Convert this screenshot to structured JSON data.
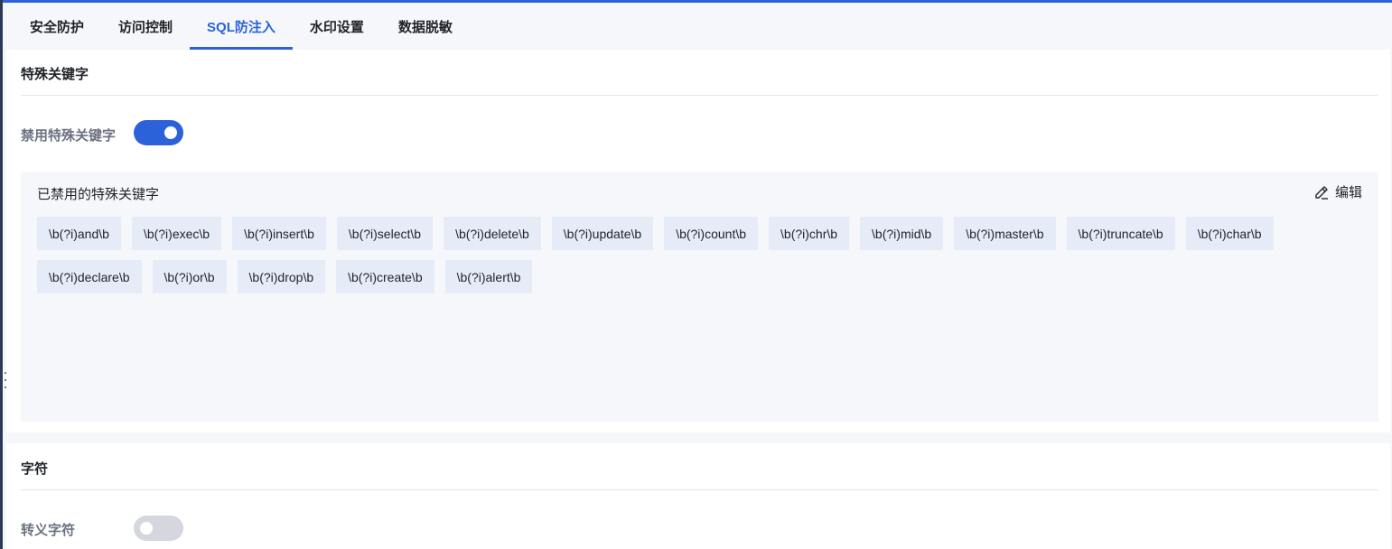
{
  "tabs": [
    {
      "label": "安全防护",
      "active": false
    },
    {
      "label": "访问控制",
      "active": false
    },
    {
      "label": "SQL防注入",
      "active": true
    },
    {
      "label": "水印设置",
      "active": false
    },
    {
      "label": "数据脱敏",
      "active": false
    }
  ],
  "special_keywords": {
    "section_title": "特殊关键字",
    "toggle_label": "禁用特殊关键字",
    "toggle_on": true,
    "list_title": "已禁用的特殊关键字",
    "edit_label": "编辑",
    "keywords": [
      "\\b(?i)and\\b",
      "\\b(?i)exec\\b",
      "\\b(?i)insert\\b",
      "\\b(?i)select\\b",
      "\\b(?i)delete\\b",
      "\\b(?i)update\\b",
      "\\b(?i)count\\b",
      "\\b(?i)chr\\b",
      "\\b(?i)mid\\b",
      "\\b(?i)master\\b",
      "\\b(?i)truncate\\b",
      "\\b(?i)char\\b",
      "\\b(?i)declare\\b",
      "\\b(?i)or\\b",
      "\\b(?i)drop\\b",
      "\\b(?i)create\\b",
      "\\b(?i)alert\\b"
    ]
  },
  "characters": {
    "section_title": "字符",
    "toggle_label": "转义字符",
    "toggle_on": false
  },
  "colors": {
    "accent": "#2b62d9",
    "toggle_off": "#d4d7dd",
    "tag_bg": "#e6ecf7"
  },
  "icons": {
    "edit": "edit-pencil-icon"
  }
}
